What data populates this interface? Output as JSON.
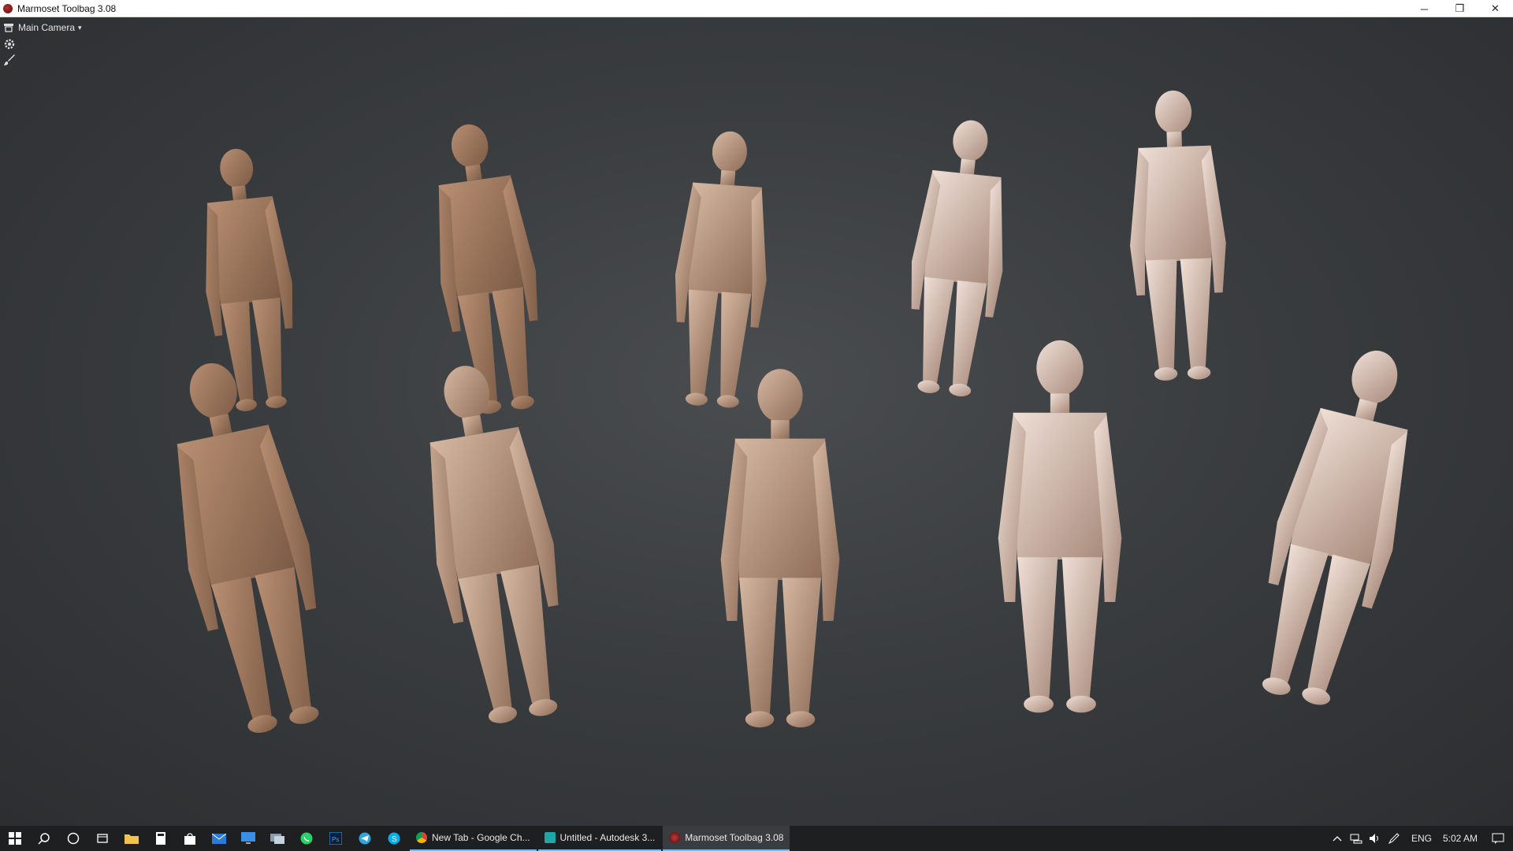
{
  "window": {
    "title": "Marmoset Toolbag 3.08",
    "controls": {
      "minimize": "─",
      "restore": "❐",
      "close": "✕"
    }
  },
  "viewport": {
    "camera_label": "Main Camera",
    "caret": "▾",
    "tools": [
      "settings-icon",
      "brush-icon"
    ]
  },
  "taskbar": {
    "pinned": [
      "windows-start-icon",
      "search-icon",
      "cortana-icon",
      "task-view-icon",
      "file-explorer-icon",
      "calculator-icon",
      "store-icon",
      "mail-icon",
      "monitor-icon",
      "remote-desktop-icon",
      "whatsapp-icon",
      "photoshop-icon",
      "telegram-icon",
      "skype-icon"
    ],
    "tasks": [
      {
        "label": "New Tab - Google Ch...",
        "icon": "chrome-icon",
        "color": "#e2b53a"
      },
      {
        "label": "Untitled - Autodesk 3...",
        "icon": "3dsmax-icon",
        "color": "#1fa7a7"
      },
      {
        "label": "Marmoset Toolbag 3.08",
        "icon": "marmoset-icon",
        "color": "#8a1a1a",
        "active": true
      }
    ],
    "tray": {
      "language": "ENG",
      "time": "5:02 AM"
    }
  }
}
